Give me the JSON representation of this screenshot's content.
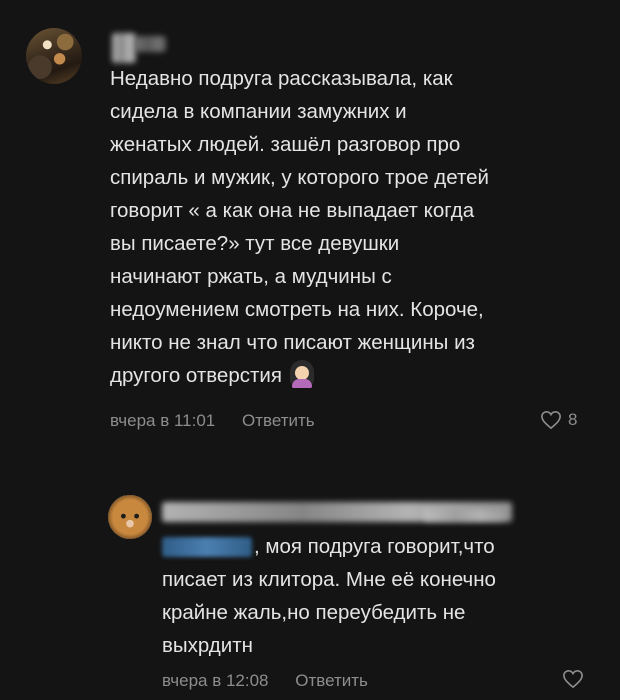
{
  "comments": [
    {
      "text": "Недавно подруга рассказывала, как\nсидела в компании замужних и\nженатых людей. зашёл разговор про\nспираль и мужик, у которого трое детей\nговорит « а как она не выпадает когда\nвы писаете?» тут все девушки\nначинают ржать, а мудчины с\nнедоумением смотреть на них. Короче,\nникто не знал что писают женщины из\nдругого отверстия",
      "emoji": "woman-facepalming-emoji",
      "time": "вчера в 11:01",
      "reply_label": "Ответить",
      "likes": "8"
    },
    {
      "text": ", моя подруга говорит,что\nписает из клитора. Мне её конечно\nкрайне жаль,но переубедить не\nвыхрдитн",
      "time": "вчера в 12:08",
      "reply_label": "Ответить"
    }
  ],
  "colors": {
    "background": "#141414",
    "text": "#e4e4e4",
    "muted": "#8d8d8d",
    "mention": "#4b7fb1"
  },
  "icons": [
    "heart-icon"
  ]
}
